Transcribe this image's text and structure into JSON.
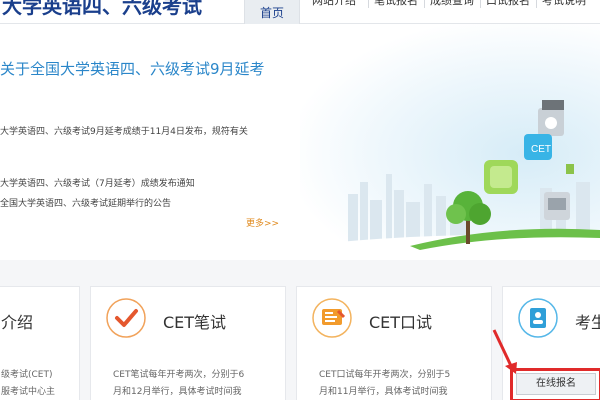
{
  "header": {
    "site_title": "大学英语四、六级考试",
    "nav_active": "首页",
    "nav_items": [
      "网站介绍",
      "笔试报名",
      "成绩查询",
      "口试报名",
      "考试说明"
    ]
  },
  "banner": {
    "headline": "关于全国大学英语四、六级考试9月延考",
    "news": [
      "大学英语四、六级考试9月延考成绩于11月4日发布，规符有关",
      "大学英语四、六级考试（7月延考）成绩发布通知",
      "全国大学英语四、六级考试延期举行的公告"
    ],
    "more": "更多>>"
  },
  "cards": [
    {
      "title": "介绍",
      "desc": [
        "级考试(CET)",
        "服考试中心主"
      ]
    },
    {
      "title": "CET笔试",
      "desc": [
        "CET笔试每年开考两次，分别于6",
        "月和12月举行，具体考试时间我"
      ]
    },
    {
      "title": "CET口试",
      "desc": [
        "CET口试每年开考两次，分别于5",
        "月和11月举行，具体考试时间我"
      ]
    },
    {
      "title": "考生",
      "desc": []
    }
  ],
  "register_button": "在线报名",
  "colors": {
    "brand_blue": "#1a3f8c",
    "accent_blue": "#2a86c9",
    "red": "#e02a2a",
    "orange": "#e08a1e"
  }
}
